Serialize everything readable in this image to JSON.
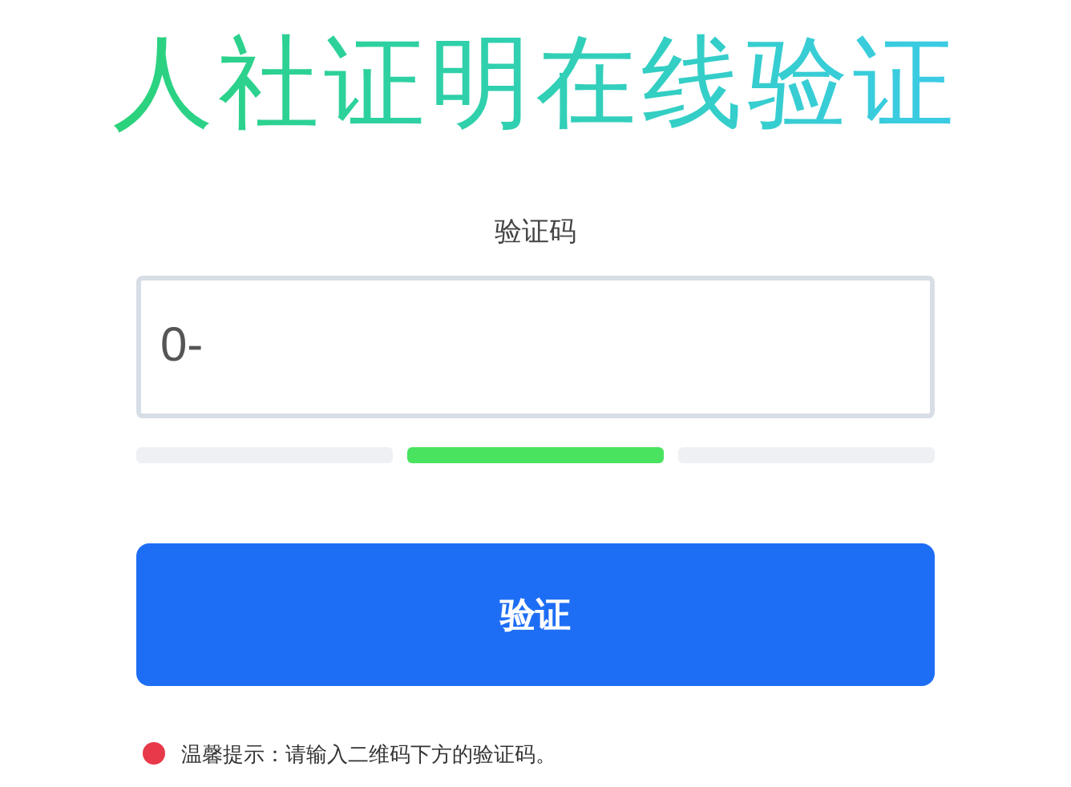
{
  "title": "人社证明在线验证",
  "field": {
    "label": "验证码",
    "value": "0-"
  },
  "strength_meter": {
    "segments": [
      {
        "on": false
      },
      {
        "on": true
      },
      {
        "on": false
      }
    ]
  },
  "button": "验证",
  "tip": {
    "color": "#e8394a",
    "text": "温馨提示：请输入二维码下方的验证码。"
  }
}
